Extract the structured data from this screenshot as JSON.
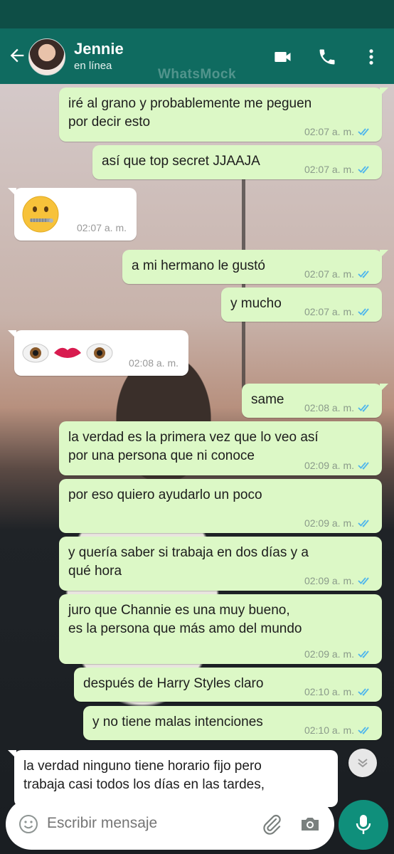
{
  "header": {
    "contact_name": "Jennie",
    "status": "en línea",
    "watermark": "WhatsMock"
  },
  "messages": [
    {
      "dir": "out",
      "text": "iré al grano y probablemente me peguen\npor decir esto",
      "time": "02:07 a. m."
    },
    {
      "dir": "out",
      "text": "así que top secret JJAAJA",
      "time": "02:07 a. m."
    },
    {
      "dir": "in",
      "emoji": "zipper-mouth-face",
      "time": "02:07 a. m."
    },
    {
      "dir": "out",
      "text": "a mi hermano le gustó",
      "time": "02:07 a. m."
    },
    {
      "dir": "out",
      "text": "y mucho",
      "time": "02:07 a. m."
    },
    {
      "dir": "in",
      "emoji": "eyes-lips-eyes",
      "time": "02:08 a. m."
    },
    {
      "dir": "out",
      "text": "same",
      "time": "02:08 a. m."
    },
    {
      "dir": "out",
      "text": "la verdad es la primera vez que lo veo así\npor una persona que ni conoce",
      "time": "02:09 a. m."
    },
    {
      "dir": "out",
      "text": "por eso quiero ayudarlo un poco",
      "time": "02:09 a. m."
    },
    {
      "dir": "out",
      "text": "y quería saber si trabaja en dos días y a\nqué hora",
      "time": "02:09 a. m."
    },
    {
      "dir": "out",
      "text": "juro que Channie es una muy bueno,\nes la persona que más amo del mundo",
      "time": "02:09 a. m."
    },
    {
      "dir": "out",
      "text": "después de Harry Styles claro",
      "time": "02:10 a. m."
    },
    {
      "dir": "out",
      "text": "y no tiene malas intenciones",
      "time": "02:10 a. m."
    },
    {
      "dir": "in",
      "text": "la verdad ninguno tiene horario fijo pero\ntrabaja casi todos los días en las tardes,",
      "time": ""
    }
  ],
  "composer": {
    "placeholder": "Escribir mensaje"
  },
  "colors": {
    "header": "#0f6b60",
    "outgoing_bubble": "#dcf8c6",
    "incoming_bubble": "#ffffff",
    "read_ticks": "#4fb6ec",
    "mic_button": "#0f8f7b"
  }
}
